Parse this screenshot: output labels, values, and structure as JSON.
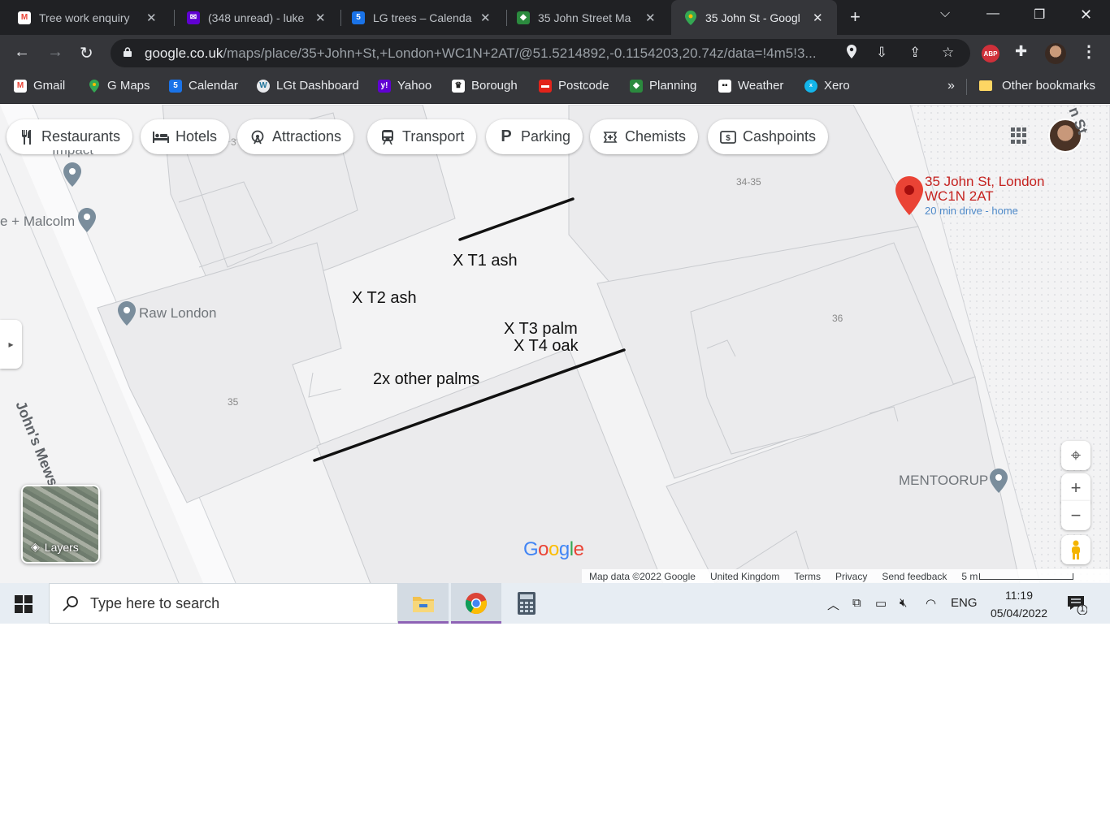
{
  "browser": {
    "tabs": [
      {
        "title": "Tree work enquiry",
        "icon": "gmail-icon",
        "color": "#ea4335"
      },
      {
        "title": "(348 unread) - luke",
        "icon": "yahoo-mail-icon",
        "color": "#6001d2"
      },
      {
        "title": "LG trees – Calenda",
        "icon": "calendar-icon",
        "color": "#1a73e8"
      },
      {
        "title": "35 John Street Ma",
        "icon": "planning-icon",
        "color": "#2b8a3e"
      },
      {
        "title": "35 John St - Googl",
        "icon": "google-maps-icon",
        "color": "#34a853",
        "active": true
      }
    ],
    "url_host": "google.co.uk",
    "url_path": "/maps/place/35+John+St,+London+WC1N+2AT/@51.5214892,-0.1154203,20.74z/data=!4m5!3...",
    "abp_label": "ABP",
    "bookmarks": [
      {
        "label": "Gmail",
        "icon": "gmail-icon",
        "color": "#ea4335"
      },
      {
        "label": "G Maps",
        "icon": "google-maps-icon",
        "color": "#34a853"
      },
      {
        "label": "Calendar",
        "icon": "calendar-icon",
        "color": "#1a73e8"
      },
      {
        "label": "LGt Dashboard",
        "icon": "wordpress-icon",
        "color": "#21759b"
      },
      {
        "label": "Yahoo",
        "icon": "yahoo-icon",
        "color": "#6001d2"
      },
      {
        "label": "Borough",
        "icon": "borough-icon",
        "color": "#222222"
      },
      {
        "label": "Postcode",
        "icon": "postcode-icon",
        "color": "#e2231a"
      },
      {
        "label": "Planning",
        "icon": "planning-icon",
        "color": "#2b8a3e"
      },
      {
        "label": "Weather",
        "icon": "weather-icon",
        "color": "#111111"
      },
      {
        "label": "Xero",
        "icon": "xero-icon",
        "color": "#13b5ea"
      }
    ],
    "more_label": "»",
    "other_bookmarks": "Other bookmarks"
  },
  "map": {
    "chips": [
      {
        "label": "Restaurants",
        "icon": "restaurant-icon"
      },
      {
        "label": "Hotels",
        "icon": "hotel-icon"
      },
      {
        "label": "Attractions",
        "icon": "attraction-icon"
      },
      {
        "label": "Transport",
        "icon": "transit-icon"
      },
      {
        "label": "Parking",
        "icon": "parking-icon"
      },
      {
        "label": "Chemists",
        "icon": "pharmacy-icon"
      },
      {
        "label": "Cashpoints",
        "icon": "atm-icon"
      }
    ],
    "pois": {
      "impact": "Impact",
      "malcolm": "e + Malcolm",
      "raw_london": "Raw London",
      "mentoorup": "MENTOORUP"
    },
    "annotations": {
      "t1": "X T1 ash",
      "t2": "X T2 ash",
      "t3": "X T3 palm",
      "t4": "X T4 oak",
      "others": "2x other palms"
    },
    "house_numbers": {
      "n3435": "34-35",
      "n36": "36",
      "n35": "35",
      "n3": "3"
    },
    "streets": {
      "johns_mews": "John's Mews",
      "john_st": "n St"
    },
    "place": {
      "title": "35 John St, London WC1N 2AT",
      "subtitle": "20 min drive - home",
      "pin_color": "#ea4335"
    },
    "layers_label": "Layers",
    "google_logo": "Google",
    "footer": {
      "map_data": "Map data ©2022 Google",
      "region": "United Kingdom",
      "terms": "Terms",
      "privacy": "Privacy",
      "feedback": "Send feedback",
      "scale": "5 m"
    }
  },
  "taskbar": {
    "search_placeholder": "Type here to search",
    "apps": [
      "file-explorer-icon",
      "chrome-icon",
      "calculator-icon"
    ],
    "language": "ENG",
    "time": "11:19",
    "date": "05/04/2022",
    "notifications": "1"
  }
}
